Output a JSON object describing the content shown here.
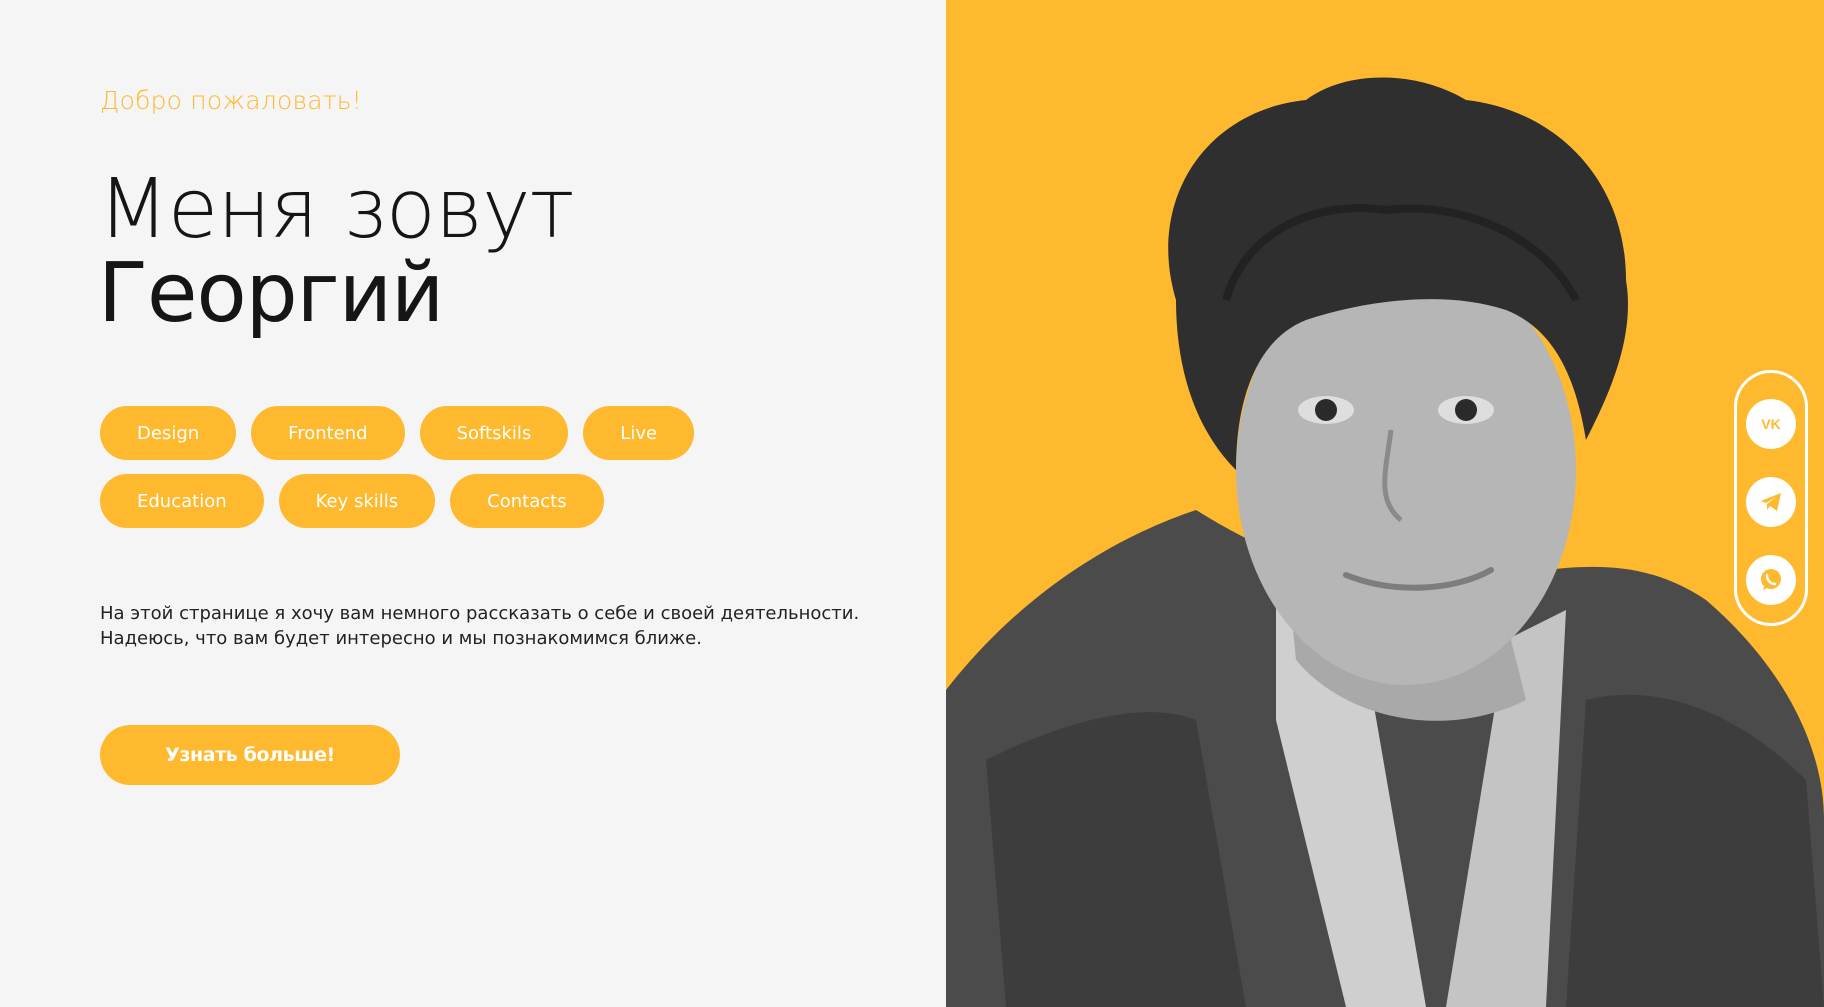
{
  "hero": {
    "welcome": "Добро пожаловать!",
    "title_line1": "Меня зовут",
    "title_line2": "Георгий",
    "tags": [
      "Design",
      "Frontend",
      "Softskils",
      "Live",
      "Education",
      "Key skills",
      "Contacts"
    ],
    "intro_line1": "На этой странице я хочу вам немного рассказать о себе и своей деятельности.",
    "intro_line2": "Надеюсь, что вам будет интересно и мы познакомимся ближе.",
    "cta_label": "Узнать больше!"
  },
  "social": {
    "icons": [
      "vk-icon",
      "telegram-icon",
      "whatsapp-icon"
    ]
  },
  "colors": {
    "accent": "#ffb92e",
    "background": "#f5f5f5",
    "text": "#151515"
  }
}
